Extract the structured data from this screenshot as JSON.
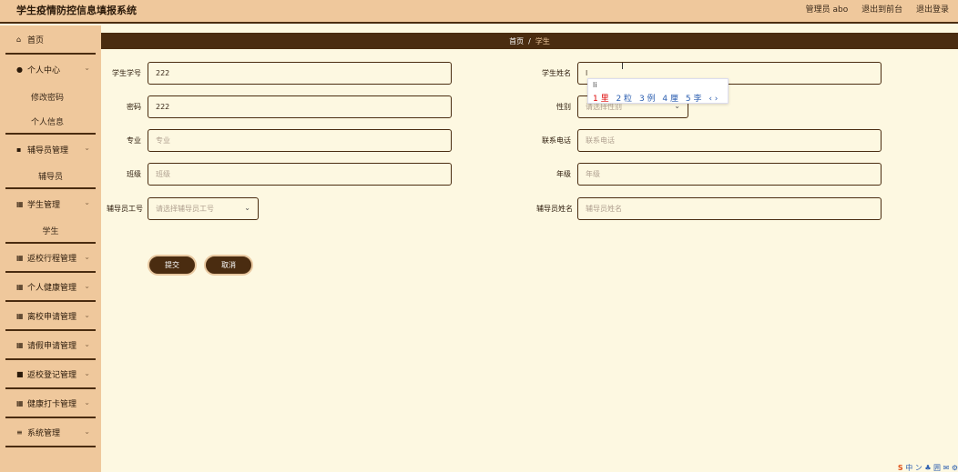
{
  "header": {
    "app_title": "学生疫情防控信息填报系统",
    "user_label": "管理员 abo",
    "front_link": "退出到前台",
    "logout_link": "退出登录"
  },
  "sidebar": {
    "home": "首页",
    "personal_center": "个人中心",
    "change_password": "修改密码",
    "personal_info": "个人信息",
    "counselor_mgmt": "辅导员管理",
    "counselor": "辅导员",
    "student_mgmt": "学生管理",
    "student": "学生",
    "return_trip_mgmt": "返校行程管理",
    "health_mgmt": "个人健康管理",
    "leave_school_mgmt": "离校申请管理",
    "leave_request_mgmt": "请假申请管理",
    "return_register_mgmt": "返校登记管理",
    "checkin_mgmt": "健康打卡管理",
    "system_mgmt": "系统管理"
  },
  "breadcrumb": {
    "home": "首页",
    "separator": "/",
    "current": "学生"
  },
  "form": {
    "student_id_label": "学生学号",
    "student_id_value": "222",
    "student_name_label": "学生姓名",
    "student_name_value": "l",
    "password_label": "密码",
    "password_value": "222",
    "gender_label": "性别",
    "gender_placeholder": "请选择性别",
    "major_label": "专业",
    "major_placeholder": "专业",
    "phone_label": "联系电话",
    "phone_placeholder": "联系电话",
    "class_label": "班级",
    "class_placeholder": "班级",
    "grade_label": "年级",
    "grade_placeholder": "年级",
    "counselor_id_label": "辅导员工号",
    "counselor_id_placeholder": "请选择辅导员工号",
    "counselor_name_label": "辅导员姓名",
    "counselor_name_placeholder": "辅导员姓名",
    "submit": "提交",
    "cancel": "取消"
  },
  "ime": {
    "typed": "li",
    "candidates": [
      "1 里",
      "2 粒",
      "3 例",
      "4 厘",
      "5 李",
      "‹ ›"
    ]
  },
  "tray": {
    "text": "中 ン ♣ 囲 ✉ ⚙"
  }
}
